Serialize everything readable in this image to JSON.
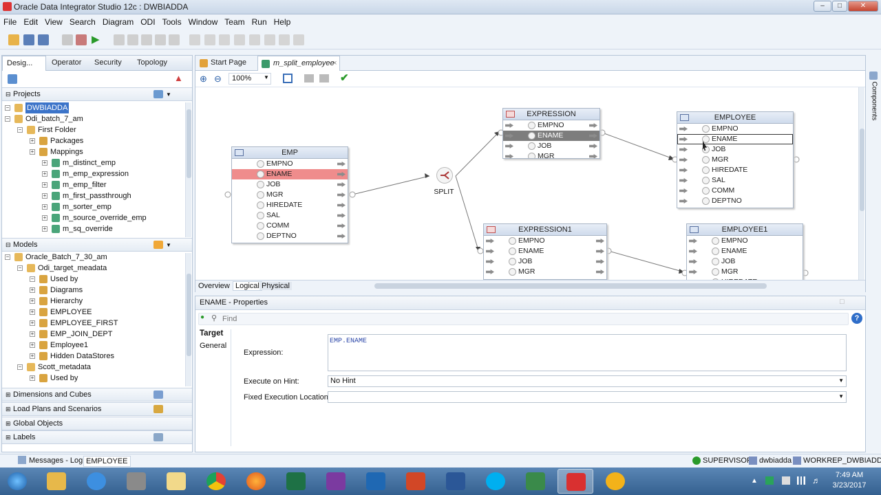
{
  "window": {
    "title": "Oracle Data Integrator Studio 12c : DWBIADDA"
  },
  "menu": [
    "File",
    "Edit",
    "View",
    "Search",
    "Diagram",
    "ODI",
    "Tools",
    "Window",
    "Team",
    "Run",
    "Help"
  ],
  "left_tabs": [
    "Desig...",
    "Operator",
    "Security",
    "Topology"
  ],
  "projects": {
    "header": "Projects",
    "items": [
      {
        "label": "DWBIADDA",
        "level": 0,
        "selected": true
      },
      {
        "label": "Odi_batch_7_am",
        "level": 0
      },
      {
        "label": "First Folder",
        "level": 1
      },
      {
        "label": "Packages",
        "level": 2
      },
      {
        "label": "Mappings",
        "level": 2
      },
      {
        "label": "m_distinct_emp",
        "level": 3
      },
      {
        "label": "m_emp_expression",
        "level": 3
      },
      {
        "label": "m_emp_filter",
        "level": 3
      },
      {
        "label": "m_first_passthrough",
        "level": 3
      },
      {
        "label": "m_sorter_emp",
        "level": 3
      },
      {
        "label": "m_source_override_emp",
        "level": 3
      },
      {
        "label": "m_sq_override",
        "level": 3
      }
    ]
  },
  "models": {
    "header": "Models",
    "items": [
      {
        "label": "Oracle_Batch_7_30_am",
        "level": 0
      },
      {
        "label": "Odi_target_meadata",
        "level": 1
      },
      {
        "label": "Used by",
        "level": 2
      },
      {
        "label": "Diagrams",
        "level": 2
      },
      {
        "label": "Hierarchy",
        "level": 2
      },
      {
        "label": "EMPLOYEE",
        "level": 2
      },
      {
        "label": "EMPLOYEE_FIRST",
        "level": 2
      },
      {
        "label": "EMP_JOIN_DEPT",
        "level": 2
      },
      {
        "label": "Employee1",
        "level": 2
      },
      {
        "label": "Hidden DataStores",
        "level": 2
      },
      {
        "label": "Scott_metadata",
        "level": 1
      },
      {
        "label": "Used by",
        "level": 2
      }
    ]
  },
  "accordions": [
    "Dimensions and Cubes",
    "Load Plans and Scenarios",
    "Global Objects",
    "Labels"
  ],
  "editor_tabs": [
    "Start Page",
    "m_split_employee"
  ],
  "zoom": "100%",
  "canvas_tabs": [
    "Overview",
    "Logical",
    "Physical"
  ],
  "nodes": {
    "emp": {
      "title": "EMP",
      "attrs": [
        "EMPNO",
        "ENAME",
        "JOB",
        "MGR",
        "HIREDATE",
        "SAL",
        "COMM",
        "DEPTNO"
      ]
    },
    "expression": {
      "title": "EXPRESSION",
      "attrs": [
        "EMPNO",
        "ENAME",
        "JOB",
        "MGR"
      ]
    },
    "employee": {
      "title": "EMPLOYEE",
      "attrs": [
        "EMPNO",
        "ENAME",
        "JOB",
        "MGR",
        "HIREDATE",
        "SAL",
        "COMM",
        "DEPTNO"
      ]
    },
    "expression1": {
      "title": "EXPRESSION1",
      "attrs": [
        "EMPNO",
        "ENAME",
        "JOB",
        "MGR"
      ]
    },
    "employee1": {
      "title": "EMPLOYEE1",
      "attrs": [
        "EMPNO",
        "ENAME",
        "JOB",
        "MGR",
        "HIREDATE"
      ]
    },
    "split": {
      "label": "SPLIT"
    }
  },
  "properties": {
    "title": "ENAME - Properties",
    "find_placeholder": "Find",
    "side_tabs": [
      "Target",
      "General"
    ],
    "expression_label": "Expression:",
    "expression_value": "EMP.ENAME",
    "hint_label": "Execute on Hint:",
    "hint_value": "No Hint",
    "location_label": "Fixed Execution Location:",
    "location_value": ""
  },
  "status": {
    "left_tabs": [
      "Messages - Log",
      "EMPLOYEE"
    ],
    "user": "SUPERVISOR",
    "db": "dwbiadda",
    "repo": "WORKREP_DWBIADDA"
  },
  "clock": {
    "time": "7:49 AM",
    "date": "3/23/2017"
  },
  "components_label": "Components"
}
